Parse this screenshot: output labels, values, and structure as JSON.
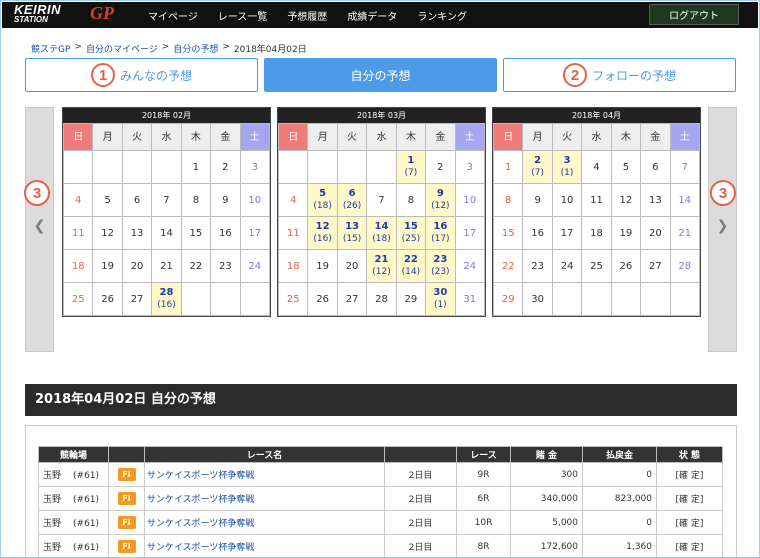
{
  "header": {
    "logo_top": "KEIRIN",
    "logo_bottom": "STATION",
    "logo_gp": "GP",
    "nav": [
      "マイページ",
      "レース一覧",
      "予想履歴",
      "成績データ",
      "ランキング"
    ],
    "logout": "ログアウト"
  },
  "breadcrumb": [
    "競ステGP",
    "自分のマイページ",
    "自分の予想",
    "2018年04月02日"
  ],
  "tabs": [
    {
      "num": "1",
      "label": "みんなの予想"
    },
    {
      "num": "",
      "label": "自分の予想"
    },
    {
      "num": "2",
      "label": "フォローの予想"
    }
  ],
  "side_badge": "3",
  "weekdays": [
    "日",
    "月",
    "火",
    "水",
    "木",
    "金",
    "土"
  ],
  "calendars": [
    {
      "title": "2018年 02月",
      "weeks": [
        [
          {
            "d": ""
          },
          {
            "d": ""
          },
          {
            "d": ""
          },
          {
            "d": ""
          },
          {
            "d": "1"
          },
          {
            "d": "2"
          },
          {
            "d": "3"
          }
        ],
        [
          {
            "d": "4"
          },
          {
            "d": "5"
          },
          {
            "d": "6"
          },
          {
            "d": "7"
          },
          {
            "d": "8"
          },
          {
            "d": "9"
          },
          {
            "d": "10"
          }
        ],
        [
          {
            "d": "11"
          },
          {
            "d": "12"
          },
          {
            "d": "13"
          },
          {
            "d": "14"
          },
          {
            "d": "15"
          },
          {
            "d": "16"
          },
          {
            "d": "17"
          }
        ],
        [
          {
            "d": "18"
          },
          {
            "d": "19"
          },
          {
            "d": "20"
          },
          {
            "d": "21"
          },
          {
            "d": "22"
          },
          {
            "d": "23"
          },
          {
            "d": "24"
          }
        ],
        [
          {
            "d": "25"
          },
          {
            "d": "26"
          },
          {
            "d": "27"
          },
          {
            "d": "28",
            "c": "(16)"
          },
          {
            "d": ""
          },
          {
            "d": ""
          },
          {
            "d": ""
          }
        ]
      ]
    },
    {
      "title": "2018年 03月",
      "weeks": [
        [
          {
            "d": ""
          },
          {
            "d": ""
          },
          {
            "d": ""
          },
          {
            "d": ""
          },
          {
            "d": "1",
            "c": "(7)"
          },
          {
            "d": "2"
          },
          {
            "d": "3"
          }
        ],
        [
          {
            "d": "4"
          },
          {
            "d": "5",
            "c": "(18)"
          },
          {
            "d": "6",
            "c": "(26)"
          },
          {
            "d": "7"
          },
          {
            "d": "8"
          },
          {
            "d": "9",
            "c": "(12)"
          },
          {
            "d": "10"
          }
        ],
        [
          {
            "d": "11"
          },
          {
            "d": "12",
            "c": "(16)"
          },
          {
            "d": "13",
            "c": "(15)"
          },
          {
            "d": "14",
            "c": "(18)"
          },
          {
            "d": "15",
            "c": "(25)"
          },
          {
            "d": "16",
            "c": "(17)"
          },
          {
            "d": "17"
          }
        ],
        [
          {
            "d": "18"
          },
          {
            "d": "19"
          },
          {
            "d": "20"
          },
          {
            "d": "21",
            "c": "(12)"
          },
          {
            "d": "22",
            "c": "(14)"
          },
          {
            "d": "23",
            "c": "(23)"
          },
          {
            "d": "24"
          }
        ],
        [
          {
            "d": "25"
          },
          {
            "d": "26"
          },
          {
            "d": "27"
          },
          {
            "d": "28"
          },
          {
            "d": "29"
          },
          {
            "d": "30",
            "c": "(1)"
          },
          {
            "d": "31"
          }
        ]
      ]
    },
    {
      "title": "2018年 04月",
      "weeks": [
        [
          {
            "d": "1"
          },
          {
            "d": "2",
            "c": "(7)"
          },
          {
            "d": "3",
            "c": "(1)"
          },
          {
            "d": "4"
          },
          {
            "d": "5"
          },
          {
            "d": "6"
          },
          {
            "d": "7"
          }
        ],
        [
          {
            "d": "8"
          },
          {
            "d": "9"
          },
          {
            "d": "10"
          },
          {
            "d": "11"
          },
          {
            "d": "12"
          },
          {
            "d": "13"
          },
          {
            "d": "14"
          }
        ],
        [
          {
            "d": "15"
          },
          {
            "d": "16"
          },
          {
            "d": "17"
          },
          {
            "d": "18"
          },
          {
            "d": "19"
          },
          {
            "d": "20"
          },
          {
            "d": "21"
          }
        ],
        [
          {
            "d": "22"
          },
          {
            "d": "23"
          },
          {
            "d": "24"
          },
          {
            "d": "25"
          },
          {
            "d": "26"
          },
          {
            "d": "27"
          },
          {
            "d": "28"
          }
        ],
        [
          {
            "d": "29"
          },
          {
            "d": "30"
          },
          {
            "d": ""
          },
          {
            "d": ""
          },
          {
            "d": ""
          },
          {
            "d": ""
          },
          {
            "d": ""
          }
        ]
      ]
    }
  ],
  "section_title": "2018年04月02日 自分の予想",
  "results": {
    "columns": [
      "競輪場",
      "",
      "レース名",
      "",
      "レース",
      "賭 金",
      "払戻金",
      "状 態"
    ],
    "rows": [
      {
        "venue": "玉野",
        "no": "(#61)",
        "grade": "FI",
        "race": "サンケイスポーツ杯争奪戦",
        "day": "2日目",
        "r": "9R",
        "bet": "300",
        "payout": "0",
        "status": "[確 定]"
      },
      {
        "venue": "玉野",
        "no": "(#61)",
        "grade": "FI",
        "race": "サンケイスポーツ杯争奪戦",
        "day": "2日目",
        "r": "6R",
        "bet": "340,000",
        "payout": "823,000",
        "status": "[確 定]"
      },
      {
        "venue": "玉野",
        "no": "(#61)",
        "grade": "FI",
        "race": "サンケイスポーツ杯争奪戦",
        "day": "2日目",
        "r": "10R",
        "bet": "5,000",
        "payout": "0",
        "status": "[確 定]"
      },
      {
        "venue": "玉野",
        "no": "(#61)",
        "grade": "FI",
        "race": "サンケイスポーツ杯争奪戦",
        "day": "2日目",
        "r": "8R",
        "bet": "172,600",
        "payout": "1,360",
        "status": "[確 定]"
      }
    ]
  }
}
